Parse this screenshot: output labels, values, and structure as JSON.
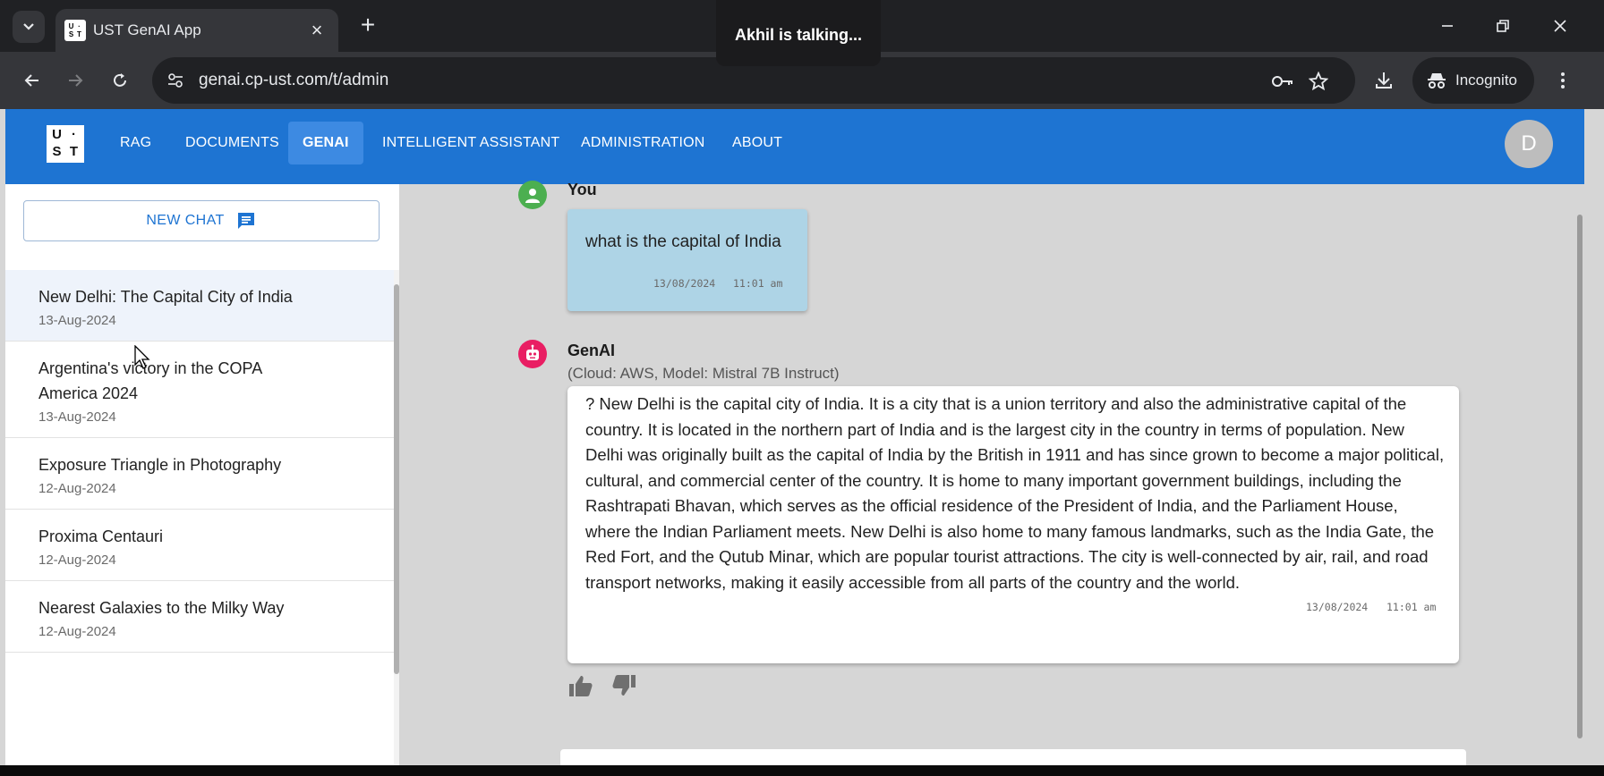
{
  "browser": {
    "tab_title": "UST GenAI App",
    "url": "genai.cp-ust.com/t/admin",
    "incognito_label": "Incognito",
    "toast": "Akhil is talking..."
  },
  "app": {
    "logo_letters": [
      "U",
      "·",
      "S",
      "T"
    ],
    "nav": [
      {
        "label": "RAG"
      },
      {
        "label": "DOCUMENTS"
      },
      {
        "label": "GENAI",
        "active": true
      },
      {
        "label": "INTELLIGENT ASSISTANT"
      },
      {
        "label": "ADMINISTRATION"
      },
      {
        "label": "ABOUT"
      }
    ],
    "avatar_initial": "D"
  },
  "sidebar": {
    "new_chat_label": "NEW CHAT",
    "chats": [
      {
        "title": "New Delhi: The Capital City of India",
        "date": "13-Aug-2024",
        "selected": true
      },
      {
        "title": "Argentina's victory in the COPA America 2024",
        "date": "13-Aug-2024"
      },
      {
        "title": "Exposure Triangle in Photography",
        "date": "12-Aug-2024"
      },
      {
        "title": "Proxima Centauri",
        "date": "12-Aug-2024"
      },
      {
        "title": "Nearest Galaxies to the Milky Way",
        "date": "12-Aug-2024"
      }
    ]
  },
  "conversation": {
    "user": {
      "author": "You",
      "text": "what is the capital of India",
      "date": "13/08/2024",
      "time": "11:01 am"
    },
    "bot": {
      "author": "GenAI",
      "model_info": "(Cloud: AWS, Model: Mistral 7B Instruct)",
      "text": "? New Delhi is the capital city of India. It is a city that is a union territory and also the administrative capital of the country. It is located in the northern part of India and is the largest city in the country in terms of population. New Delhi was originally built as the capital of India by the British in 1911 and has since grown to become a major political, cultural, and commercial center of the country. It is home to many important government buildings, including the Rashtrapati Bhavan, which serves as the official residence of the President of India, and the Parliament House, where the Indian Parliament meets. New Delhi is also home to many famous landmarks, such as the India Gate, the Red Fort, and the Qutub Minar, which are popular tourist attractions. The city is well-connected by air, rail, and road transport networks, making it easily accessible from all parts of the country and the world.",
      "date": "13/08/2024",
      "time": "11:01 am"
    }
  },
  "colors": {
    "app_bar": "#1e74d2",
    "user_bubble": "#aed4e6",
    "user_avatar": "#4caf50",
    "bot_avatar": "#e91e63"
  }
}
